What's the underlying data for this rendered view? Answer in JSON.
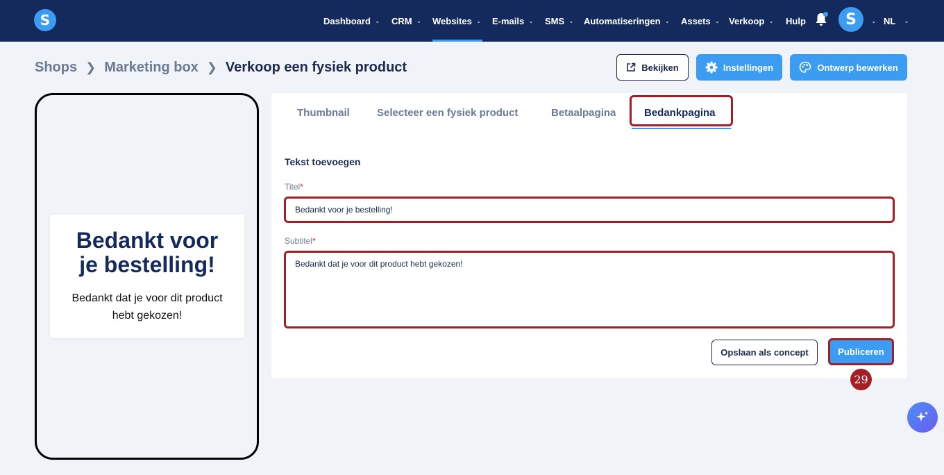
{
  "brand": {
    "logo_letter": "S"
  },
  "nav": {
    "items": [
      {
        "label": "Dashboard",
        "has_dropdown": true
      },
      {
        "label": "CRM",
        "has_dropdown": true
      },
      {
        "label": "Websites",
        "has_dropdown": true,
        "active": true
      },
      {
        "label": "E-mails",
        "has_dropdown": true
      },
      {
        "label": "SMS",
        "has_dropdown": true
      },
      {
        "label": "Automatiseringen",
        "has_dropdown": true
      },
      {
        "label": "Assets",
        "has_dropdown": true
      },
      {
        "label": "Verkoop",
        "has_dropdown": true
      },
      {
        "label": "Hulp",
        "has_dropdown": false
      }
    ],
    "avatar_letter": "S",
    "language": "NL",
    "notification_icon": "bell-icon"
  },
  "breadcrumb": {
    "items": [
      "Shops",
      "Marketing box"
    ],
    "current": "Verkoop een fysiek product"
  },
  "header_buttons": {
    "view": "Bekijken",
    "settings": "Instellingen",
    "edit_design": "Ontwerp bewerken"
  },
  "preview": {
    "title": "Bedankt voor je bestelling!",
    "subtitle": "Bedankt dat je voor dit product hebt gekozen!"
  },
  "tabs": [
    {
      "label": "Thumbnail"
    },
    {
      "label": "Selecteer een fysiek product"
    },
    {
      "label": "Betaalpagina"
    },
    {
      "label": "Bedankpagina",
      "active": true
    }
  ],
  "form": {
    "section_title": "Tekst toevoegen",
    "title_label": "Titel",
    "title_value": "Bedankt voor je bestelling!",
    "subtitle_label": "Subtitel",
    "subtitle_value": "Bedankt dat je voor dit product hebt gekozen!",
    "required_mark": "*",
    "save_draft": "Opslaan als concept",
    "publish": "Publiceren"
  },
  "step_badge": "29",
  "colors": {
    "navbar": "#142a5c",
    "accent": "#3b9cf2",
    "highlight": "#a41e25"
  }
}
